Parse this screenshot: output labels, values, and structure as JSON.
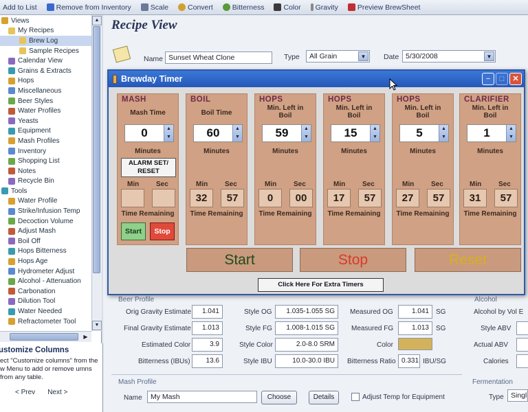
{
  "toolbar": {
    "items": [
      {
        "label": "Add to List",
        "icon": "add-icon"
      },
      {
        "label": "Remove from Inventory",
        "icon": "remove-inventory-icon"
      },
      {
        "label": "Scale",
        "icon": "scale-icon"
      },
      {
        "label": "Convert",
        "icon": "convert-icon"
      },
      {
        "label": "Bitterness",
        "icon": "hops-icon"
      },
      {
        "label": "Color",
        "icon": "color-icon"
      },
      {
        "label": "Gravity",
        "icon": "hydrometer-icon"
      },
      {
        "label": "Preview BrewSheet",
        "icon": "preview-icon"
      }
    ]
  },
  "sidebar": {
    "tree": [
      {
        "label": "Views",
        "indent": 0
      },
      {
        "label": "My Recipes",
        "indent": 1
      },
      {
        "label": "Brew Log",
        "indent": 2,
        "selected": true
      },
      {
        "label": "Sample Recipes",
        "indent": 2
      },
      {
        "label": "Calendar View",
        "indent": 1
      },
      {
        "label": "Grains & Extracts",
        "indent": 1
      },
      {
        "label": "Hops",
        "indent": 1
      },
      {
        "label": "Miscellaneous",
        "indent": 1
      },
      {
        "label": "Beer Styles",
        "indent": 1
      },
      {
        "label": "Water Profiles",
        "indent": 1
      },
      {
        "label": "Yeasts",
        "indent": 1
      },
      {
        "label": "Equipment",
        "indent": 1
      },
      {
        "label": "Mash Profiles",
        "indent": 1
      },
      {
        "label": "Inventory",
        "indent": 1
      },
      {
        "label": "Shopping List",
        "indent": 1
      },
      {
        "label": "Notes",
        "indent": 1
      },
      {
        "label": "Recycle Bin",
        "indent": 1
      },
      {
        "label": "Tools",
        "indent": 0
      },
      {
        "label": "Water Profile",
        "indent": 1
      },
      {
        "label": "Strike/Infusion Temp",
        "indent": 1
      },
      {
        "label": "Decoction Volume",
        "indent": 1
      },
      {
        "label": "Adjust Mash",
        "indent": 1
      },
      {
        "label": "Boil Off",
        "indent": 1
      },
      {
        "label": "Hops Bitterness",
        "indent": 1
      },
      {
        "label": "Hops Age",
        "indent": 1
      },
      {
        "label": "Hydrometer Adjust",
        "indent": 1
      },
      {
        "label": "Alcohol - Attenuation",
        "indent": 1
      },
      {
        "label": "Carbonation",
        "indent": 1
      },
      {
        "label": "Dilution Tool",
        "indent": 1
      },
      {
        "label": "Water Needed",
        "indent": 1
      },
      {
        "label": "Refractometer Tool",
        "indent": 1
      }
    ],
    "customize": {
      "title": "ustomize Columns",
      "text": "ect \"Customize columns\" from the w Menu to add or remove umns from any table.",
      "prev": "< Prev",
      "next": "Next >"
    }
  },
  "recipe": {
    "view_title": "Recipe View",
    "name_label": "Name",
    "name_value": "Sunset Wheat Clone",
    "type_label": "Type",
    "type_value": "All Grain",
    "date_label": "Date",
    "date_value": "5/30/2008"
  },
  "timer": {
    "title": "Brewday Timer",
    "panels": [
      {
        "title": "MASH",
        "sub": "Mash Time",
        "value": "0",
        "minutes_label": "Minutes",
        "alarm_label": "ALARM SET/ RESET",
        "min_label": "Min",
        "sec_label": "Sec",
        "min": "",
        "sec": "",
        "remaining_label": "Time Remaining",
        "start_label": "Start",
        "stop_label": "Stop"
      },
      {
        "title": "BOIL",
        "sub": "Boil Time",
        "value": "60",
        "minutes_label": "Minutes",
        "min_label": "Min",
        "sec_label": "Sec",
        "min": "32",
        "sec": "57",
        "remaining_label": "Time Remaining"
      },
      {
        "title": "HOPS",
        "sub": "Min. Left in Boil",
        "value": "59",
        "minutes_label": "Minutes",
        "min_label": "Min",
        "sec_label": "Sec",
        "min": "0",
        "sec": "00",
        "remaining_label": "Time Remaining"
      },
      {
        "title": "HOPS",
        "sub": "Min. Left in Boil",
        "value": "15",
        "minutes_label": "Minutes",
        "min_label": "Min",
        "sec_label": "Sec",
        "min": "17",
        "sec": "57",
        "remaining_label": "Time Remaining"
      },
      {
        "title": "HOPS",
        "sub": "Min. Left in Boil",
        "value": "5",
        "minutes_label": "Minutes",
        "min_label": "Min",
        "sec_label": "Sec",
        "min": "27",
        "sec": "57",
        "remaining_label": "Time Remaining"
      },
      {
        "title": "CLARIFIER",
        "sub": "Min. Left in Boil",
        "value": "1",
        "minutes_label": "Minutes",
        "min_label": "Min",
        "sec_label": "Sec",
        "min": "31",
        "sec": "57",
        "remaining_label": "Time Remaining"
      }
    ],
    "start_label": "Start",
    "stop_label": "Stop",
    "reset_label": "Reset",
    "extra_label": "Click Here For Extra Timers"
  },
  "profile": {
    "section_label": "Beer Profile",
    "orig_gravity_label": "Orig Gravity Estimate",
    "orig_gravity": "1.041",
    "final_gravity_label": "Final Gravity Estimate",
    "final_gravity": "1.013",
    "est_color_label": "Estimated Color",
    "est_color": "3.9",
    "bitterness_label": "Bitterness (IBUs)",
    "bitterness": "13.6",
    "style_og_label": "Style OG",
    "style_og": "1.035-1.055 SG",
    "style_fg_label": "Style FG",
    "style_fg": "1.008-1.015 SG",
    "style_color_label": "Style Color",
    "style_color": "2.0-8.0 SRM",
    "style_ibu_label": "Style IBU",
    "style_ibu": "10.0-30.0 IBU",
    "measured_og_label": "Measured OG",
    "measured_og": "1.041",
    "measured_fg_label": "Measured FG",
    "measured_fg": "1.013",
    "sg_unit": "SG",
    "color_label": "Color",
    "color_swatch": "#d4b25c",
    "bitterness_ratio_label": "Bitterness Ratio",
    "bitterness_ratio": "0.331",
    "ratio_unit": "IBU/SG",
    "alcohol_label": "Alcohol",
    "abv_vol_label": "Alcohol by Vol E",
    "style_abv_label": "Style ABV",
    "actual_abv_label": "Actual ABV",
    "calories_label": "Calories"
  },
  "mash": {
    "section_label": "Mash Profile",
    "name_label": "Name",
    "name_value": "My Mash",
    "choose_label": "Choose",
    "details_label": "Details",
    "adjust_label": "Adjust Temp for Equipment"
  },
  "fermentation": {
    "section_label": "Fermentation",
    "type_label": "Type",
    "type_value": "Singl"
  }
}
